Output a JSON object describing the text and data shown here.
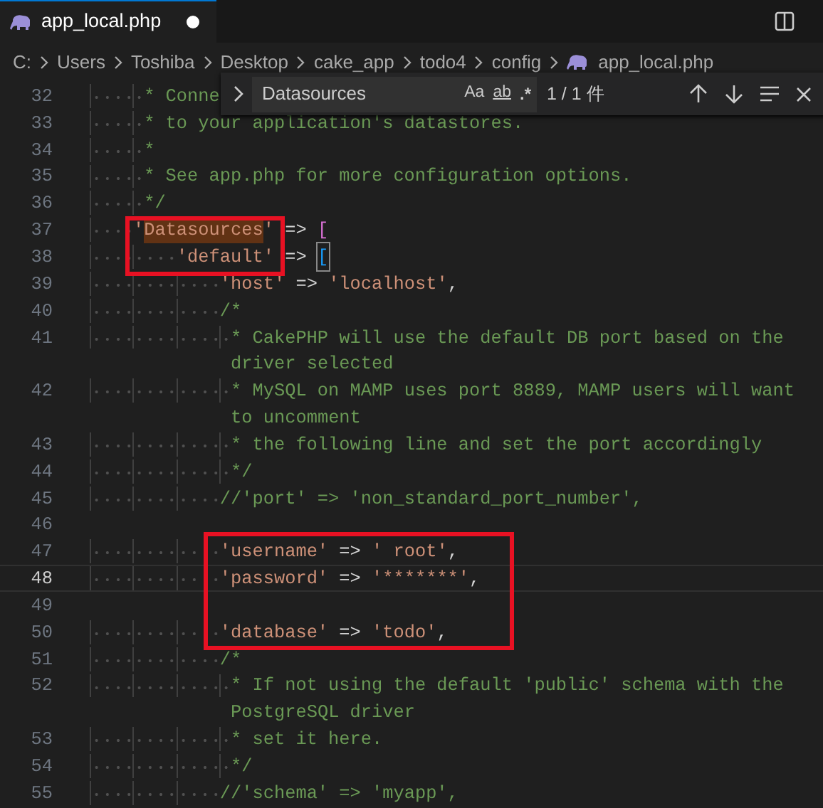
{
  "tab": {
    "label": "app_local.php",
    "modified": true
  },
  "breadcrumbs": [
    {
      "label": "C:",
      "kind": "folder"
    },
    {
      "label": "Users",
      "kind": "folder"
    },
    {
      "label": "Toshiba",
      "kind": "folder"
    },
    {
      "label": "Desktop",
      "kind": "folder"
    },
    {
      "label": "cake_app",
      "kind": "folder"
    },
    {
      "label": "todo4",
      "kind": "folder"
    },
    {
      "label": "config",
      "kind": "folder"
    },
    {
      "label": "app_local.php",
      "kind": "file"
    }
  ],
  "find": {
    "value": "Datasources",
    "match_case": "Aa",
    "whole_word": "ab",
    "regex": ".*",
    "result": "1 / 1 件"
  },
  "lines": [
    {
      "number": "32",
      "current": false,
      "segments": [
        {
          "text": "     * Conne",
          "kind": "comment"
        }
      ]
    },
    {
      "number": "33",
      "current": false,
      "segments": [
        {
          "text": "     * to your application's datastores.",
          "kind": "comment"
        }
      ]
    },
    {
      "number": "34",
      "current": false,
      "segments": [
        {
          "text": "     *",
          "kind": "comment"
        }
      ]
    },
    {
      "number": "35",
      "current": false,
      "segments": [
        {
          "text": "     * See app.php for more configuration options.",
          "kind": "comment"
        }
      ]
    },
    {
      "number": "36",
      "current": false,
      "segments": [
        {
          "text": "     */",
          "kind": "comment"
        }
      ]
    },
    {
      "number": "37",
      "current": false,
      "segments": [
        {
          "text": "    '",
          "kind": "string"
        },
        {
          "text": "Datasources",
          "kind": "string",
          "match": true
        },
        {
          "text": "'",
          "kind": "string"
        },
        {
          "text": " => ",
          "kind": "operator"
        },
        {
          "text": "[",
          "kind": "bracket",
          "color": "#da70d6"
        }
      ]
    },
    {
      "number": "38",
      "current": false,
      "segments": [
        {
          "text": "        'default'",
          "kind": "string"
        },
        {
          "text": " => ",
          "kind": "operator"
        },
        {
          "text": "[",
          "kind": "bracket",
          "color": "#179fff",
          "paired": true
        }
      ]
    },
    {
      "number": "39",
      "current": false,
      "segments": [
        {
          "text": "            'host'",
          "kind": "string"
        },
        {
          "text": " => ",
          "kind": "operator"
        },
        {
          "text": "'localhost'",
          "kind": "string"
        },
        {
          "text": ",",
          "kind": "operator"
        }
      ]
    },
    {
      "number": "40",
      "current": false,
      "segments": [
        {
          "text": "            /*",
          "kind": "comment"
        }
      ]
    },
    {
      "number": "41",
      "current": false,
      "segments": [
        {
          "text": "             * CakePHP will use the default DB port based on the",
          "kind": "comment"
        }
      ],
      "continuation": "driver selected"
    },
    {
      "number": "42",
      "current": false,
      "segments": [
        {
          "text": "             * MySQL on MAMP uses port 8889, MAMP users will want",
          "kind": "comment"
        }
      ],
      "continuation": "to uncomment"
    },
    {
      "number": "43",
      "current": false,
      "segments": [
        {
          "text": "             * the following line and set the port accordingly",
          "kind": "comment"
        }
      ]
    },
    {
      "number": "44",
      "current": false,
      "segments": [
        {
          "text": "             */",
          "kind": "comment"
        }
      ]
    },
    {
      "number": "45",
      "current": false,
      "segments": [
        {
          "text": "            //'port' => 'non_standard_port_number',",
          "kind": "comment"
        }
      ]
    },
    {
      "number": "46",
      "current": false
    },
    {
      "number": "47",
      "current": false,
      "segments": [
        {
          "text": "            'username'",
          "kind": "string"
        },
        {
          "text": " => ",
          "kind": "operator"
        },
        {
          "text": "' root'",
          "kind": "string"
        },
        {
          "text": ",",
          "kind": "operator"
        }
      ]
    },
    {
      "number": "48",
      "current": true,
      "segments": [
        {
          "text": "            'password'",
          "kind": "string"
        },
        {
          "text": " => ",
          "kind": "operator"
        },
        {
          "text": "'*******'",
          "kind": "string"
        },
        {
          "text": ",",
          "kind": "operator"
        }
      ]
    },
    {
      "number": "49",
      "current": false
    },
    {
      "number": "50",
      "current": false,
      "segments": [
        {
          "text": "            'database'",
          "kind": "string"
        },
        {
          "text": " => ",
          "kind": "operator"
        },
        {
          "text": "'todo'",
          "kind": "string"
        },
        {
          "text": ",",
          "kind": "operator"
        }
      ]
    },
    {
      "number": "51",
      "current": false,
      "segments": [
        {
          "text": "            /*",
          "kind": "comment"
        }
      ]
    },
    {
      "number": "52",
      "current": false,
      "segments": [
        {
          "text": "             * If not using the default 'public' schema with the",
          "kind": "comment"
        }
      ],
      "continuation": "PostgreSQL driver"
    },
    {
      "number": "53",
      "current": false,
      "segments": [
        {
          "text": "             * set it here.",
          "kind": "comment"
        }
      ]
    },
    {
      "number": "54",
      "current": false,
      "segments": [
        {
          "text": "             */",
          "kind": "comment"
        }
      ]
    },
    {
      "number": "55",
      "current": false,
      "segments": [
        {
          "text": "            //'schema' => 'myapp',",
          "kind": "comment"
        }
      ]
    }
  ]
}
